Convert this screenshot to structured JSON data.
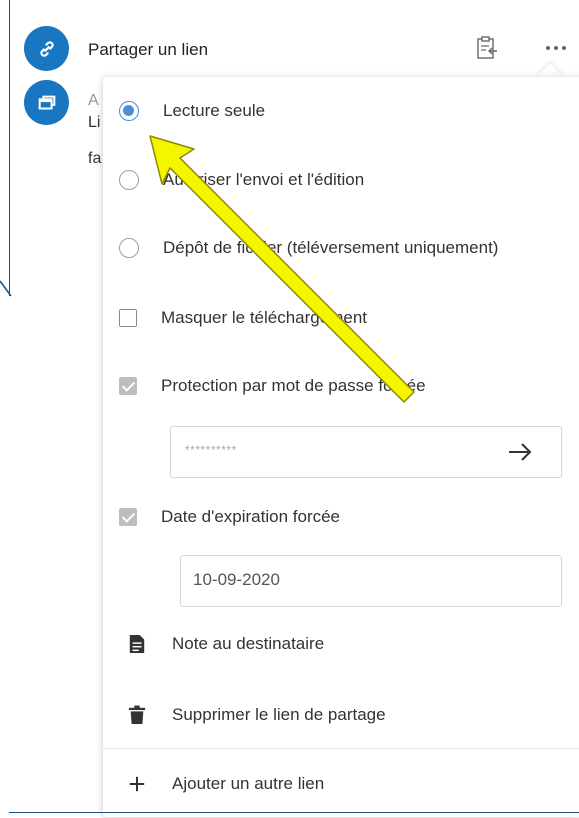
{
  "header": {
    "title": "Partager un lien",
    "link_icon": "link-icon",
    "clipboard_icon": "clipboard-icon",
    "more_icon": "more-options-icon"
  },
  "background_item": {
    "icon": "windows-icon",
    "line1": "A",
    "line2": "Li",
    "line3": "fa"
  },
  "menu": {
    "radios": [
      {
        "label": "Lecture seule",
        "checked": true
      },
      {
        "label": "Autoriser l'envoi et l'édition",
        "checked": false
      },
      {
        "label": "Dépôt de fichier (téléversement uniquement)",
        "checked": false
      }
    ],
    "hide_download": {
      "label": "Masquer le téléchargement",
      "checked": false
    },
    "password": {
      "label": "Protection par mot de passe forcée",
      "checked": true,
      "value": "**********",
      "submit_icon": "arrow-right-icon"
    },
    "expiration": {
      "label": "Date d'expiration forcée",
      "checked": true,
      "date": "10-09-2020"
    },
    "note": {
      "label": "Note au destinataire",
      "icon": "note-icon"
    },
    "delete": {
      "label": "Supprimer le lien de partage",
      "icon": "trash-icon"
    },
    "add": {
      "label": "Ajouter un autre lien",
      "icon": "plus-icon"
    }
  },
  "colors": {
    "accent": "#1976c2",
    "radio_accent": "#4a90d9",
    "arrow_fill": "#f5f500",
    "arrow_stroke": "#8a8a00"
  }
}
